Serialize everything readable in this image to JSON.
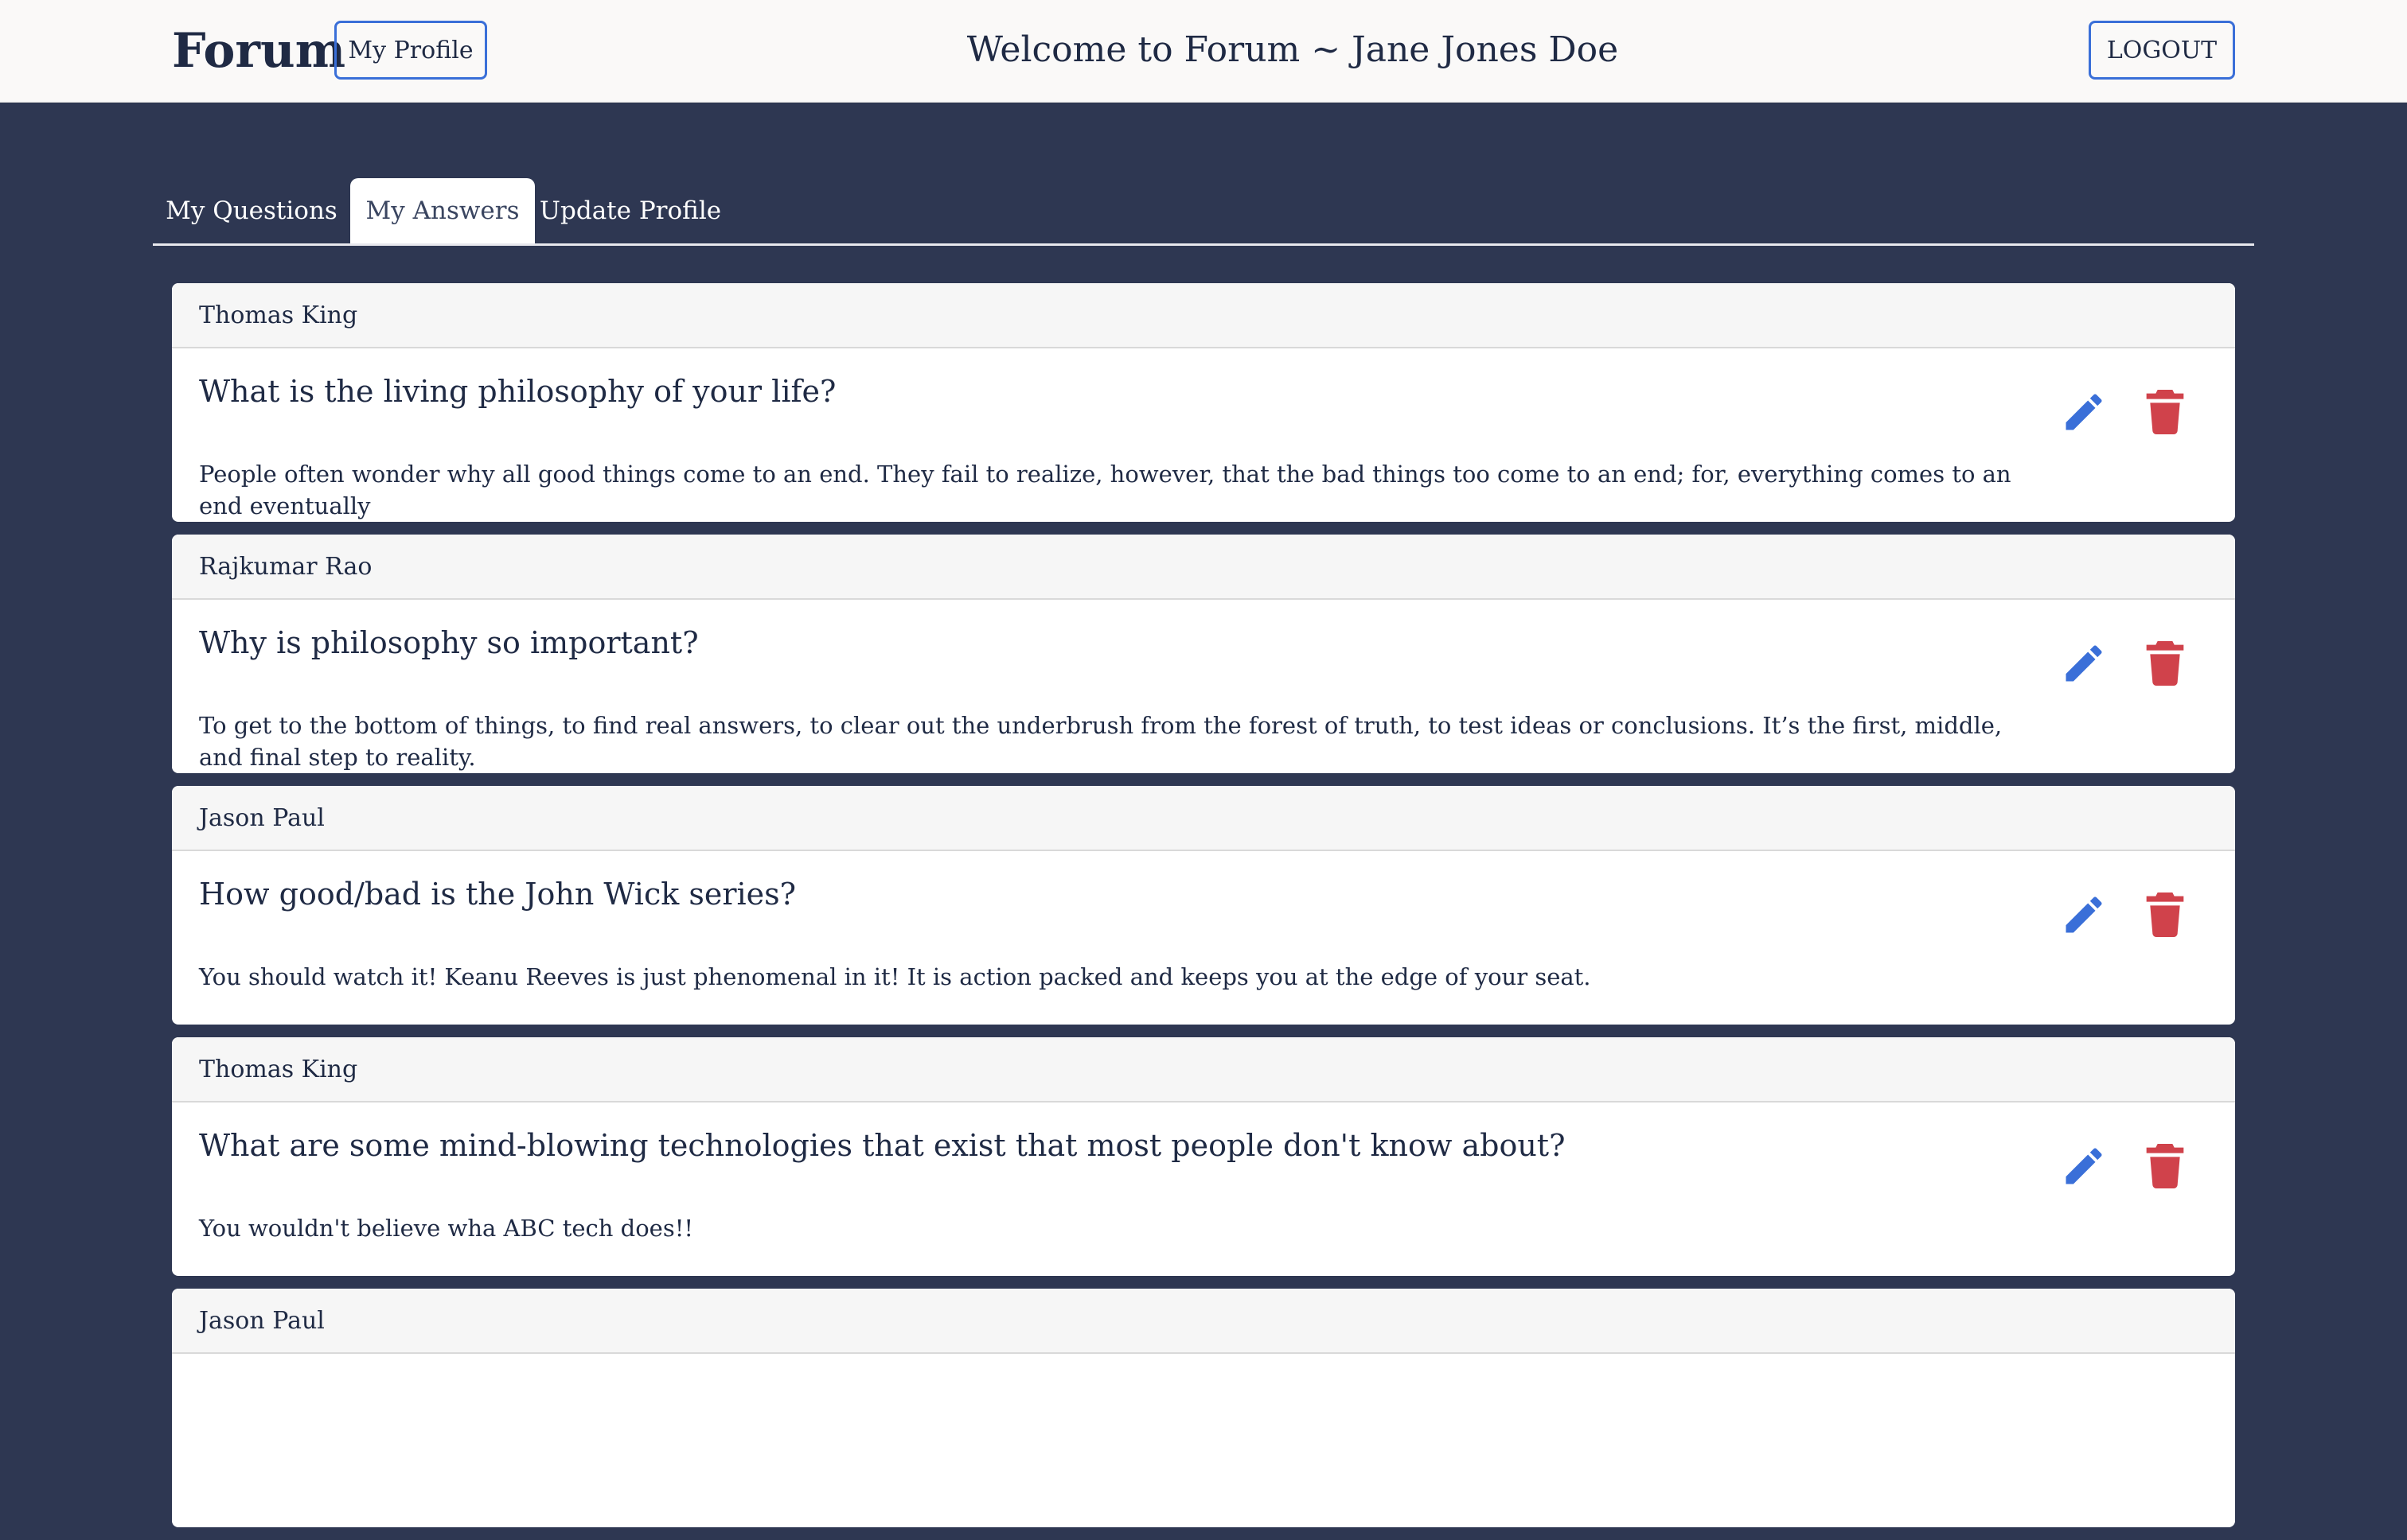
{
  "header": {
    "brand": "Forum",
    "profile_label": "My Profile",
    "welcome": "Welcome to Forum ~ Jane Jones Doe",
    "logout_label": "LOGOUT"
  },
  "tabs": [
    {
      "label": "My Questions",
      "active": false
    },
    {
      "label": "My Answers",
      "active": true
    },
    {
      "label": "Update Profile",
      "active": false
    }
  ],
  "colors": {
    "accent": "#3a6fd8",
    "delete": "#d0424b",
    "edit": "#3a6fd8",
    "page_bg": "#2e3752"
  },
  "icons": {
    "edit": "pencil-icon",
    "delete": "trash-icon"
  },
  "answers": [
    {
      "author": "Thomas King",
      "question": "What is the living philosophy of your life?",
      "answer": "People often wonder why all good things come to an end. They fail to realize, however, that the bad things too come to an end; for, everything comes to an end eventually"
    },
    {
      "author": "Rajkumar Rao",
      "question": "Why is philosophy so important?",
      "answer": "To get to the bottom of things, to find real answers, to clear out the underbrush from the forest of truth, to test ideas or conclusions. It’s the first, middle, and final step to reality."
    },
    {
      "author": "Jason Paul",
      "question": "How good/bad is the John Wick series?",
      "answer": "You should watch it! Keanu Reeves is just phenomenal in it! It is action packed and keeps you at the edge of your seat."
    },
    {
      "author": "Thomas King",
      "question": "What are some mind-blowing technologies that exist that most people don't know about?",
      "answer": "You wouldn't believe wha ABC tech does!!"
    },
    {
      "author": "Jason Paul",
      "question": "",
      "answer": ""
    }
  ]
}
